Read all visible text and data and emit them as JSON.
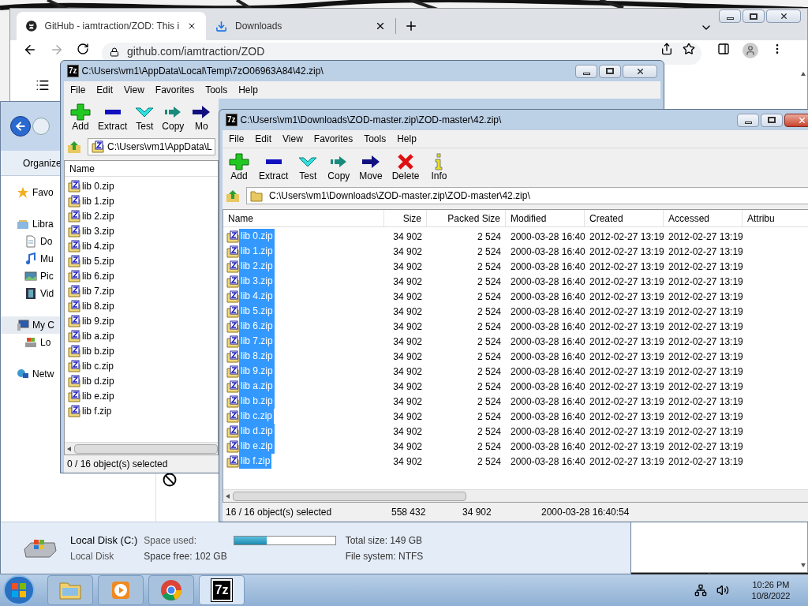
{
  "browser": {
    "tabs": [
      {
        "title": "GitHub - iamtraction/ZOD: This i",
        "kind": "github",
        "selected": true
      },
      {
        "title": "Downloads",
        "kind": "download",
        "selected": false
      }
    ],
    "address": "github.com/iamtraction/ZOD"
  },
  "explorer": {
    "organize": "Organize",
    "nav": [
      {
        "label": "Favo",
        "kind": "star",
        "selected": false
      },
      {
        "label": "Libra",
        "kind": "library",
        "selected": false,
        "children": [
          {
            "label": "Do",
            "kind": "document",
            "selected": false
          },
          {
            "label": "Mu",
            "kind": "music",
            "selected": false
          },
          {
            "label": "Pic",
            "kind": "pictures",
            "selected": false
          },
          {
            "label": "Vid",
            "kind": "video",
            "selected": false
          }
        ]
      },
      {
        "label": "My C",
        "kind": "computer",
        "selected": true,
        "children": [
          {
            "label": "Lo",
            "kind": "drive",
            "selected": false
          }
        ]
      },
      {
        "label": "Netw",
        "kind": "network",
        "selected": false
      }
    ],
    "details": {
      "name": "Local Disk (C:)",
      "type": "Local Disk",
      "used_label": "Space used:",
      "level": 0.32,
      "free": "Space free: 102 GB",
      "total": "Total size: 149 GB",
      "file_system": "File system: NTFS"
    }
  },
  "archive_back": {
    "logo": "7z",
    "title": "C:\\Users\\vm1\\AppData\\Local\\Temp\\7zO06963A84\\42.zip\\",
    "menu": [
      "File",
      "Edit",
      "View",
      "Favorites",
      "Tools",
      "Help"
    ],
    "toolbar": [
      {
        "label": "Add",
        "kind": "add"
      },
      {
        "label": "Extract",
        "kind": "extract"
      },
      {
        "label": "Test",
        "kind": "test"
      },
      {
        "label": "Copy",
        "kind": "copy"
      },
      {
        "label": "Mo",
        "kind": "move"
      }
    ],
    "address": "C:\\Users\\vm1\\AppData\\L",
    "column": "Name",
    "files": [
      "lib 0.zip",
      "lib 1.zip",
      "lib 2.zip",
      "lib 3.zip",
      "lib 4.zip",
      "lib 5.zip",
      "lib 6.zip",
      "lib 7.zip",
      "lib 8.zip",
      "lib 9.zip",
      "lib a.zip",
      "lib b.zip",
      "lib c.zip",
      "lib d.zip",
      "lib e.zip",
      "lib f.zip"
    ],
    "status": "0 / 16 object(s) selected"
  },
  "archive_front": {
    "logo": "7z",
    "title": "C:\\Users\\vm1\\Downloads\\ZOD-master.zip\\ZOD-master\\42.zip\\",
    "menu": [
      "File",
      "Edit",
      "View",
      "Favorites",
      "Tools",
      "Help"
    ],
    "toolbar": [
      {
        "label": "Add",
        "kind": "add"
      },
      {
        "label": "Extract",
        "kind": "extract"
      },
      {
        "label": "Test",
        "kind": "test"
      },
      {
        "label": "Copy",
        "kind": "copy"
      },
      {
        "label": "Move",
        "kind": "move"
      },
      {
        "label": "Delete",
        "kind": "delete"
      },
      {
        "label": "Info",
        "kind": "info"
      }
    ],
    "address": "C:\\Users\\vm1\\Downloads\\ZOD-master.zip\\ZOD-master\\42.zip\\",
    "columns": [
      "Name",
      "Size",
      "Packed Size",
      "Modified",
      "Created",
      "Accessed",
      "Attribu"
    ],
    "rows": [
      {
        "name": "lib 0.zip",
        "size": "34 902",
        "packed": "2 524",
        "modified": "2000-03-28 16:40",
        "created": "2012-02-27 13:19",
        "accessed": "2012-02-27 13:19",
        "selected": true
      },
      {
        "name": "lib 1.zip",
        "size": "34 902",
        "packed": "2 524",
        "modified": "2000-03-28 16:40",
        "created": "2012-02-27 13:19",
        "accessed": "2012-02-27 13:19",
        "selected": true
      },
      {
        "name": "lib 2.zip",
        "size": "34 902",
        "packed": "2 524",
        "modified": "2000-03-28 16:40",
        "created": "2012-02-27 13:19",
        "accessed": "2012-02-27 13:19",
        "selected": true
      },
      {
        "name": "lib 3.zip",
        "size": "34 902",
        "packed": "2 524",
        "modified": "2000-03-28 16:40",
        "created": "2012-02-27 13:19",
        "accessed": "2012-02-27 13:19",
        "selected": true
      },
      {
        "name": "lib 4.zip",
        "size": "34 902",
        "packed": "2 524",
        "modified": "2000-03-28 16:40",
        "created": "2012-02-27 13:19",
        "accessed": "2012-02-27 13:19",
        "selected": true
      },
      {
        "name": "lib 5.zip",
        "size": "34 902",
        "packed": "2 524",
        "modified": "2000-03-28 16:40",
        "created": "2012-02-27 13:19",
        "accessed": "2012-02-27 13:19",
        "selected": true
      },
      {
        "name": "lib 6.zip",
        "size": "34 902",
        "packed": "2 524",
        "modified": "2000-03-28 16:40",
        "created": "2012-02-27 13:19",
        "accessed": "2012-02-27 13:19",
        "selected": true
      },
      {
        "name": "lib 7.zip",
        "size": "34 902",
        "packed": "2 524",
        "modified": "2000-03-28 16:40",
        "created": "2012-02-27 13:19",
        "accessed": "2012-02-27 13:19",
        "selected": true
      },
      {
        "name": "lib 8.zip",
        "size": "34 902",
        "packed": "2 524",
        "modified": "2000-03-28 16:40",
        "created": "2012-02-27 13:19",
        "accessed": "2012-02-27 13:19",
        "selected": true
      },
      {
        "name": "lib 9.zip",
        "size": "34 902",
        "packed": "2 524",
        "modified": "2000-03-28 16:40",
        "created": "2012-02-27 13:19",
        "accessed": "2012-02-27 13:19",
        "selected": true
      },
      {
        "name": "lib a.zip",
        "size": "34 902",
        "packed": "2 524",
        "modified": "2000-03-28 16:40",
        "created": "2012-02-27 13:19",
        "accessed": "2012-02-27 13:19",
        "selected": true
      },
      {
        "name": "lib b.zip",
        "size": "34 902",
        "packed": "2 524",
        "modified": "2000-03-28 16:40",
        "created": "2012-02-27 13:19",
        "accessed": "2012-02-27 13:19",
        "selected": true
      },
      {
        "name": "lib c.zip",
        "size": "34 902",
        "packed": "2 524",
        "modified": "2000-03-28 16:40",
        "created": "2012-02-27 13:19",
        "accessed": "2012-02-27 13:19",
        "selected": true
      },
      {
        "name": "lib d.zip",
        "size": "34 902",
        "packed": "2 524",
        "modified": "2000-03-28 16:40",
        "created": "2012-02-27 13:19",
        "accessed": "2012-02-27 13:19",
        "selected": true
      },
      {
        "name": "lib e.zip",
        "size": "34 902",
        "packed": "2 524",
        "modified": "2000-03-28 16:40",
        "created": "2012-02-27 13:19",
        "accessed": "2012-02-27 13:19",
        "selected": true
      },
      {
        "name": "lib f.zip",
        "size": "34 902",
        "packed": "2 524",
        "modified": "2000-03-28 16:40",
        "created": "2012-02-27 13:19",
        "accessed": "2012-02-27 13:19",
        "selected": true
      }
    ],
    "status": [
      "16 / 16 object(s) selected",
      "558 432",
      "34 902",
      "2000-03-28 16:40:54"
    ]
  },
  "taskbar": {
    "apps": [
      {
        "kind": "explorer",
        "selected": false
      },
      {
        "kind": "media",
        "selected": false
      },
      {
        "kind": "chrome",
        "selected": false
      },
      {
        "kind": "sevenzip",
        "label": "7z",
        "selected": true
      }
    ],
    "time": "10:26 PM",
    "date": "10/8/2022"
  }
}
